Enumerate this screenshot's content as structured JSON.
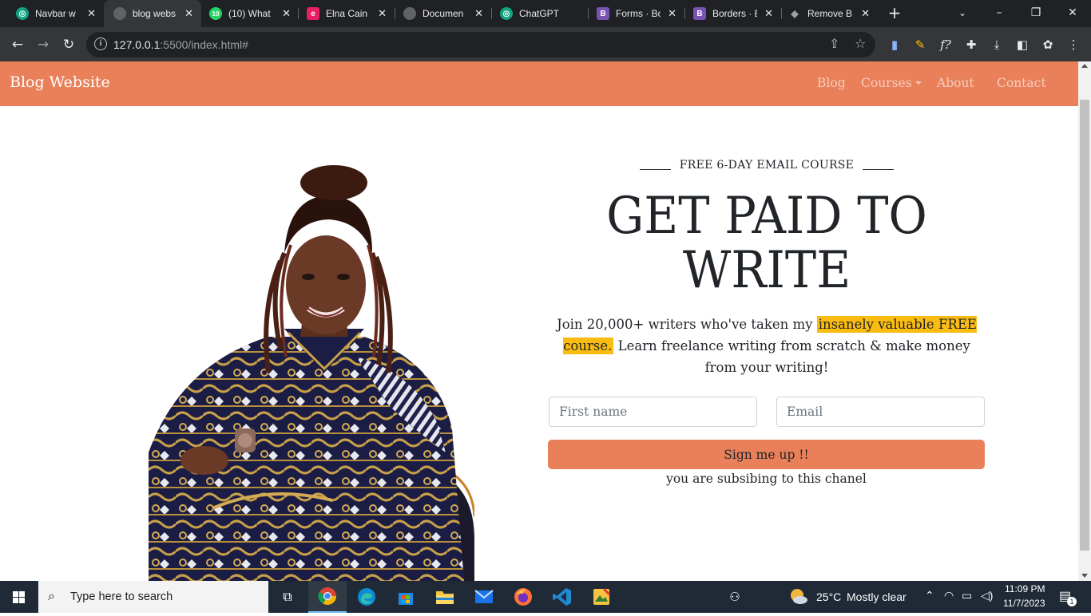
{
  "browser": {
    "tabs": [
      {
        "title": "Navbar w",
        "favicon": "chatgpt-icon",
        "color": "#10a37f",
        "active": false
      },
      {
        "title": "blog webs",
        "favicon": "globe-icon",
        "color": "#5f6368",
        "active": true
      },
      {
        "title": "(10) What",
        "favicon": "whatsapp-icon",
        "color": "#25d366",
        "active": false
      },
      {
        "title": "Elna Cain",
        "favicon": "elna-icon",
        "color": "#e91e63",
        "active": false
      },
      {
        "title": "Documen",
        "favicon": "globe-icon",
        "color": "#5f6368",
        "active": false
      },
      {
        "title": "ChatGPT",
        "favicon": "chatgpt-icon",
        "color": "#10a37f",
        "active": false
      },
      {
        "title": "Forms · Bo",
        "favicon": "bootstrap-icon",
        "color": "#7952b3",
        "active": false
      },
      {
        "title": "Borders · B",
        "favicon": "bootstrap-icon",
        "color": "#7952b3",
        "active": false
      },
      {
        "title": "Remove B",
        "favicon": "layers-icon",
        "color": "#9aa0a6",
        "active": false
      }
    ],
    "url_host": "127.0.0.1",
    "url_rest": ":5500/index.html#"
  },
  "page": {
    "brand": "Blog Website",
    "nav": {
      "blog": "Blog",
      "courses": "Courses",
      "about": "About",
      "contact": "Contact"
    },
    "hero": {
      "eyebrow": "FREE 6-DAY EMAIL COURSE",
      "headline_1": "GET PAID TO",
      "headline_2": "WRITE",
      "lead_pre": "Join 20,000+ writers who've taken my",
      "lead_highlight": "insanely valuable FREE course.",
      "lead_post": "Learn freelance writing from scratch & make money from your writing!",
      "first_name_placeholder": "First name",
      "email_placeholder": "Email",
      "submit_label": "Sign me up !!",
      "subnote": "you are subsibing to this chanel"
    },
    "colors": {
      "accent": "#e9805a",
      "highlight": "#fbbc12"
    }
  },
  "taskbar": {
    "search_placeholder": "Type here to search",
    "weather_temp": "25°C",
    "weather_desc": "Mostly clear",
    "time": "11:09 PM",
    "date": "11/7/2023",
    "notification_count": "1"
  }
}
